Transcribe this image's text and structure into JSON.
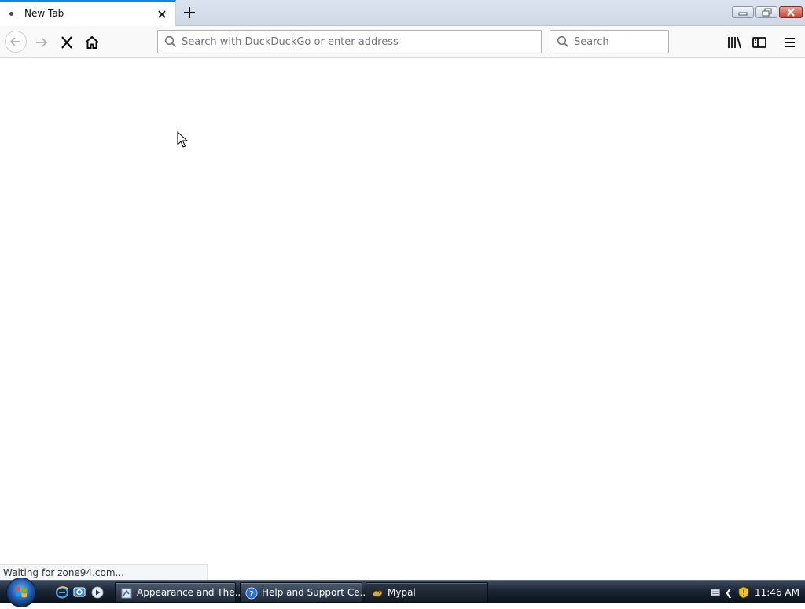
{
  "browser": {
    "tab": {
      "title": "New Tab"
    },
    "urlbar": {
      "placeholder": "Search with DuckDuckGo or enter address",
      "value": ""
    },
    "searchbar": {
      "placeholder": "Search",
      "value": ""
    },
    "status_text": "Waiting for zone94.com..."
  },
  "taskbar": {
    "tasks": [
      {
        "label": "Appearance and The...",
        "icon": "control-panel-icon"
      },
      {
        "label": "Help and Support Ce...",
        "icon": "help-icon"
      },
      {
        "label": "Mypal",
        "icon": "mypal-icon"
      }
    ],
    "clock": "11:46 AM"
  },
  "colors": {
    "accent": "#0a84ff",
    "toolbar_bg": "#f9f9fa",
    "taskbar_bg": "#1b2533"
  }
}
